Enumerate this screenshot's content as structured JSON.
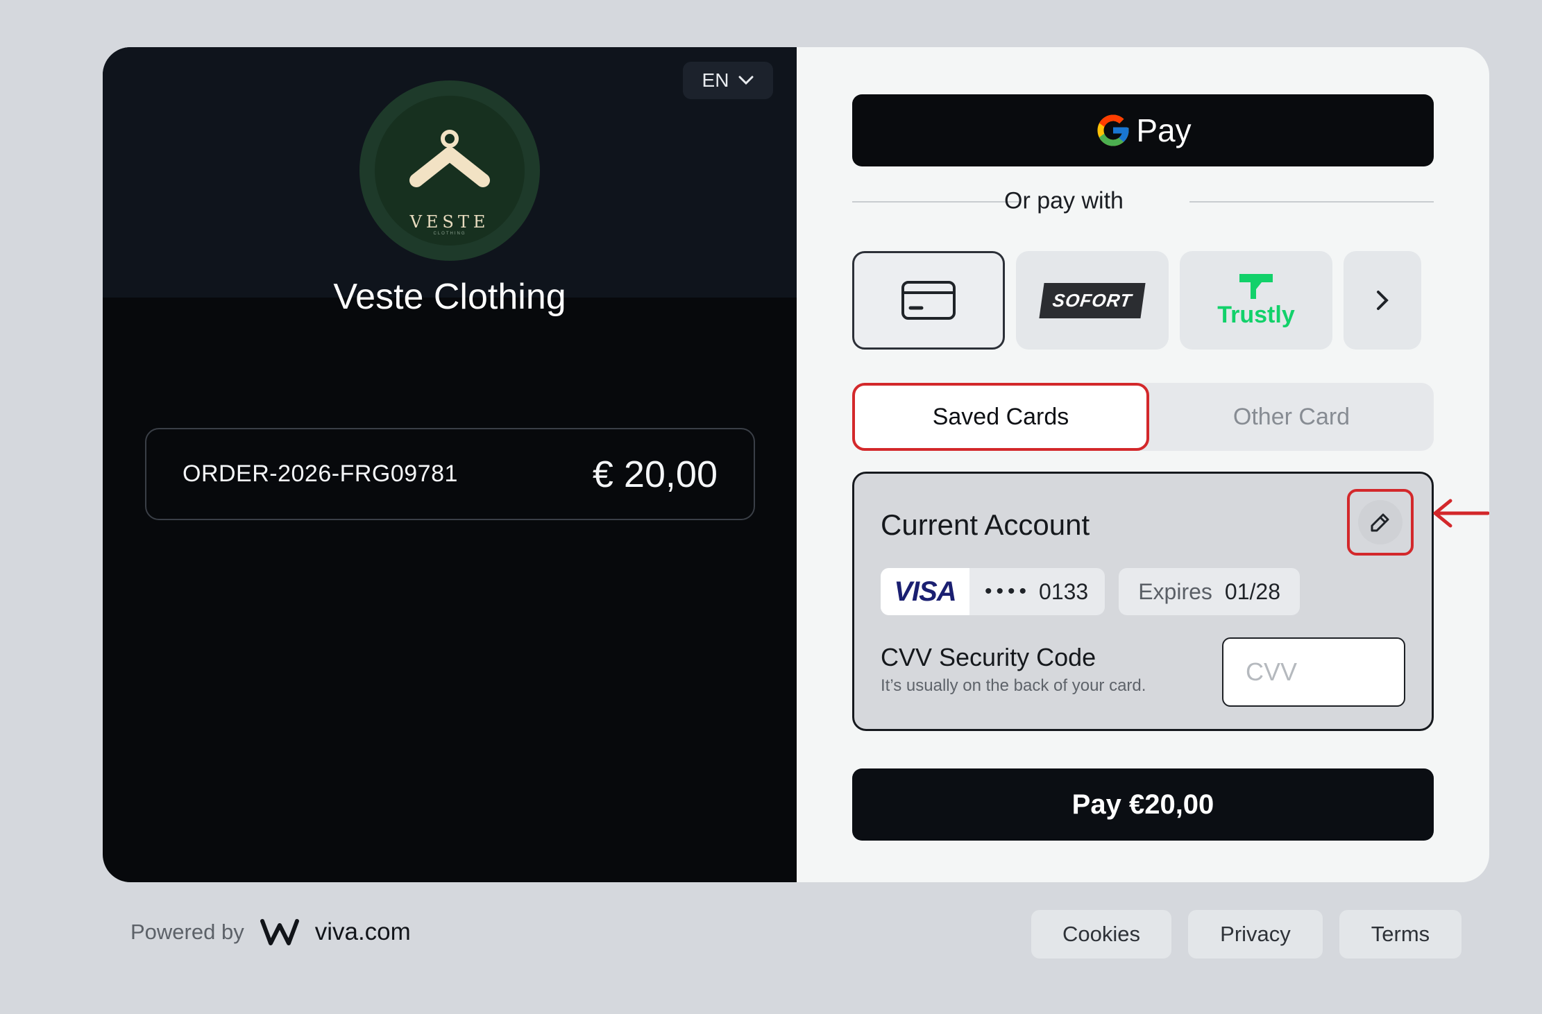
{
  "merchant": {
    "name": "Veste Clothing",
    "logo_word": "VESTE",
    "logo_sub": "CLOTHING",
    "language": "EN"
  },
  "order": {
    "id": "ORDER-2026-FRG09781",
    "amount": "€ 20,00"
  },
  "payment": {
    "gpay_label": "Pay",
    "or_pay_with": "Or pay with",
    "methods": [
      {
        "name": "card",
        "icon": "credit-card-icon",
        "selected": true
      },
      {
        "name": "sofort",
        "label": "SOFORT"
      },
      {
        "name": "trustly",
        "label": "Trustly"
      },
      {
        "name": "more",
        "icon": "chevron-right-icon"
      }
    ],
    "tabs": {
      "saved": "Saved Cards",
      "other": "Other Card"
    },
    "saved_card": {
      "title": "Current Account",
      "brand": "VISA",
      "dots": "••••",
      "last4": "0133",
      "expires_label": "Expires",
      "expires_value": "01/28",
      "cvv_title": "CVV Security Code",
      "cvv_hint": "It’s usually on the back of your card.",
      "cvv_placeholder": "CVV"
    },
    "pay_button": "Pay €20,00"
  },
  "footer": {
    "powered_by": "Powered by",
    "brand": "viva.com",
    "links": [
      "Cookies",
      "Privacy",
      "Terms"
    ]
  },
  "colors": {
    "highlight_red": "#d3282b",
    "trustly_green": "#12d16a",
    "visa_blue": "#1a1f71"
  }
}
